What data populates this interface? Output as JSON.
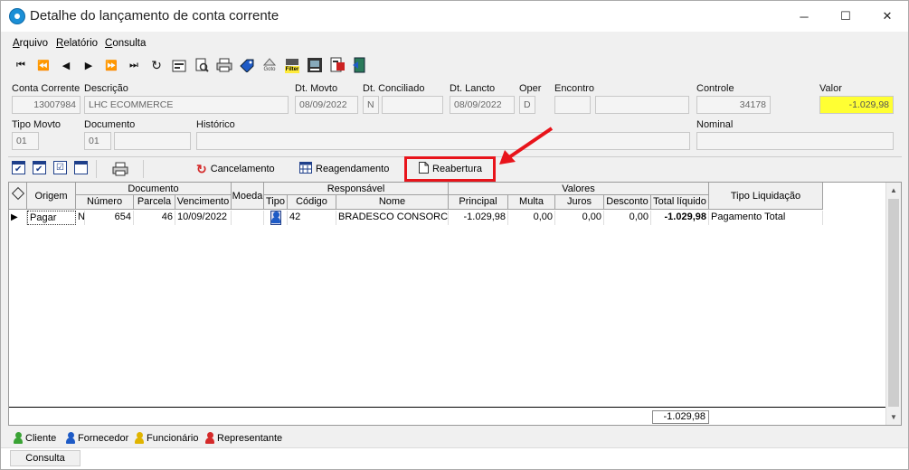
{
  "window": {
    "title": "Detalhe do lançamento de conta corrente",
    "minimize": "─",
    "maximize": "☐",
    "close": "✕"
  },
  "menu": [
    {
      "label": "Arquivo",
      "u": "A",
      "rest": "rquivo"
    },
    {
      "label": "Relatório",
      "u": "R",
      "rest": "elatório"
    },
    {
      "label": "Consulta",
      "u": "C",
      "rest": "onsulta"
    }
  ],
  "toolbar_icons": [
    "first-icon",
    "prev-page-icon",
    "prev-icon",
    "next-icon",
    "next-page-icon",
    "last-icon",
    "refresh-icon",
    "properties-icon",
    "print-preview-icon",
    "print-icon",
    "tag-icon",
    "goto-icon",
    "filter-icon",
    "report-icon",
    "export-icon",
    "exit-icon"
  ],
  "toolbar_text": {
    "goto": "Goto",
    "filter": "Filter"
  },
  "form": {
    "conta_corrente": {
      "label": "Conta Corrente",
      "value": "13007984"
    },
    "descricao": {
      "label": "Descrição",
      "value": "LHC ECOMMERCE"
    },
    "dt_movto": {
      "label": "Dt. Movto",
      "value": "08/09/2022"
    },
    "dt_conciliado": {
      "label": "Dt. Conciliado",
      "value1": "N",
      "value2": ""
    },
    "dt_lancto": {
      "label": "Dt. Lancto",
      "value": "08/09/2022"
    },
    "oper": {
      "label": "Oper",
      "value": "D"
    },
    "encontro": {
      "label": "Encontro",
      "value1": "",
      "value2": ""
    },
    "controle": {
      "label": "Controle",
      "value": "34178"
    },
    "valor": {
      "label": "Valor",
      "value": "-1.029,98"
    },
    "tipo_movto": {
      "label": "Tipo Movto",
      "value": "01"
    },
    "documento": {
      "label": "Documento",
      "value1": "01",
      "value2": ""
    },
    "historico": {
      "label": "Histórico",
      "value": ""
    },
    "nominal": {
      "label": "Nominal",
      "value": ""
    }
  },
  "actions": {
    "cancelamento": "Cancelamento",
    "reagendamento": "Reagendamento",
    "reabertura": "Reabertura"
  },
  "grid": {
    "groups": {
      "documento": "Documento",
      "responsavel": "Responsável",
      "valores": "Valores"
    },
    "headers": {
      "origem": "Origem",
      "numero": "Número",
      "parcela": "Parcela",
      "vencimento": "Vencimento",
      "moeda": "Moeda",
      "tipo": "Tipo",
      "codigo": "Código",
      "nome": "Nome",
      "principal": "Principal",
      "multa": "Multa",
      "juros": "Juros",
      "desconto": "Desconto",
      "total_liquido": "Total líquido",
      "tipo_liquidacao": "Tipo Liquidação"
    },
    "row": {
      "origem": "Pagar",
      "flag": "N",
      "numero": "654",
      "parcela": "46",
      "vencimento": "10/09/2022",
      "moeda": "",
      "codigo": "42",
      "nome": "BRADESCO CONSORCIOS",
      "principal": "-1.029,98",
      "multa": "0,00",
      "juros": "0,00",
      "desconto": "0,00",
      "total_liquido": "-1.029,98",
      "tipo_liquidacao": "Pagamento Total"
    },
    "total": "-1.029,98"
  },
  "legend": [
    {
      "label": "Cliente",
      "color": "#3aa335"
    },
    {
      "label": "Fornecedor",
      "color": "#1e5bc6"
    },
    {
      "label": "Funcionário",
      "color": "#e0b400"
    },
    {
      "label": "Representante",
      "color": "#d42a2a"
    }
  ],
  "tabs": [
    "Consulta"
  ],
  "colors": {
    "highlight": "#e8141b",
    "arrow": "#e8141b",
    "valor_bg": "#ffff33"
  }
}
